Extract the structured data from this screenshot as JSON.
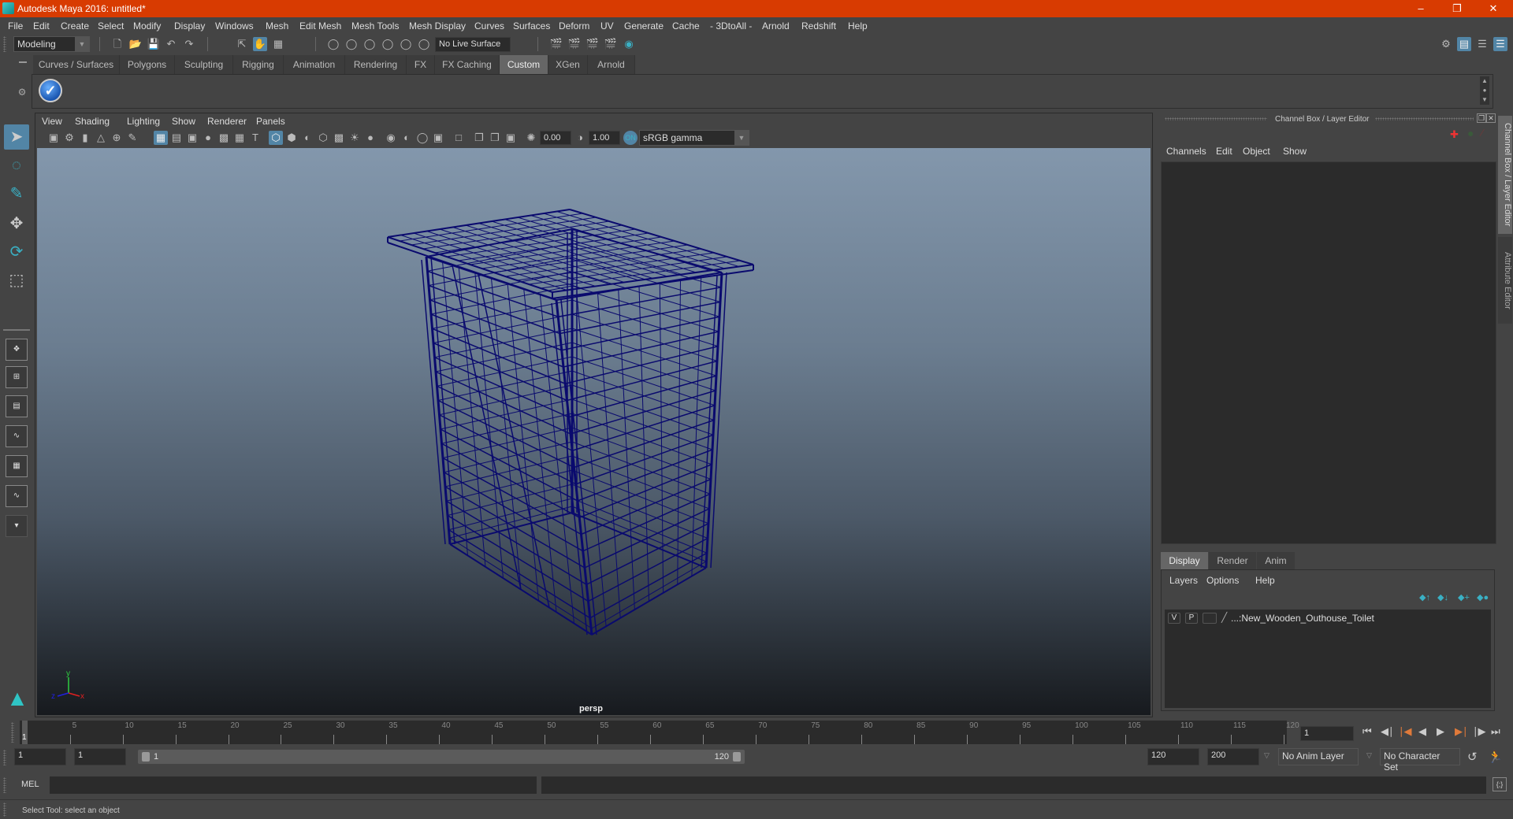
{
  "window": {
    "title": "Autodesk Maya 2016: untitled*",
    "controls": [
      "minimize",
      "restore",
      "close"
    ]
  },
  "menubar": [
    "File",
    "Edit",
    "Create",
    "Select",
    "Modify",
    "Display",
    "Windows",
    "Mesh",
    "Edit Mesh",
    "Mesh Tools",
    "Mesh Display",
    "Curves",
    "Surfaces",
    "Deform",
    "UV",
    "Generate",
    "Cache",
    "- 3DtoAll -",
    "Arnold",
    "Redshift",
    "Help"
  ],
  "statusline": {
    "menuset": "Modeling",
    "live_surface": "No Live Surface"
  },
  "shelf": {
    "tabs": [
      "Curves / Surfaces",
      "Polygons",
      "Sculpting",
      "Rigging",
      "Animation",
      "Rendering",
      "FX",
      "FX Caching",
      "Custom",
      "XGen",
      "Arnold"
    ],
    "active_tab": "Custom"
  },
  "viewport": {
    "menu": [
      "View",
      "Shading",
      "Lighting",
      "Show",
      "Renderer",
      "Panels"
    ],
    "exposure": "0.00",
    "gamma": "1.00",
    "color_space": "sRGB gamma",
    "camera": "persp",
    "axis": {
      "x": "x",
      "y": "y",
      "z": "z"
    },
    "wire_color": "#0a0a6e"
  },
  "channel_box": {
    "title": "Channel Box / Layer Editor",
    "menu": [
      "Channels",
      "Edit",
      "Object",
      "Show"
    ],
    "layer_tabs": [
      "Display",
      "Render",
      "Anim"
    ],
    "active_layer_tab": "Display",
    "layer_menu": [
      "Layers",
      "Options",
      "Help"
    ],
    "layers": [
      {
        "visible": "V",
        "playback": "P",
        "name": "...:New_Wooden_Outhouse_Toilet"
      }
    ]
  },
  "side_tabs": [
    "Channel Box / Layer Editor",
    "Attribute Editor"
  ],
  "timeline": {
    "ticks": [
      "5",
      "10",
      "15",
      "20",
      "25",
      "30",
      "35",
      "40",
      "45",
      "50",
      "55",
      "60",
      "65",
      "70",
      "75",
      "80",
      "85",
      "90",
      "95",
      "100",
      "105",
      "110",
      "115",
      "120"
    ],
    "current_frame_marker": "1",
    "current_frame": "1"
  },
  "range": {
    "start_time": "1",
    "playback_start": "1",
    "range_start_label": "1",
    "range_end_label": "120",
    "playback_end": "120",
    "end_time": "200",
    "anim_layer": "No Anim Layer",
    "character_set": "No Character Set"
  },
  "command_line": {
    "label": "MEL"
  },
  "help_line": "Select Tool: select an object"
}
